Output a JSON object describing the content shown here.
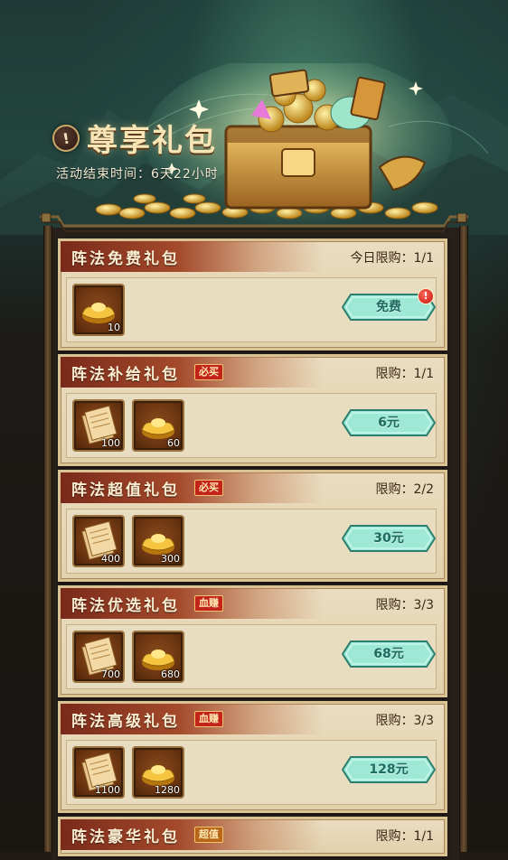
{
  "header": {
    "title_icon": "!",
    "title": "尊享礼包",
    "subtitle": "活动结束时间：6天22小时"
  },
  "colors": {
    "ribbon": "#a44a2c",
    "card_bg": "#e2d1ad",
    "button_teal": "#8fe0d0",
    "tag_red": "#c2241b",
    "tag_gold": "#b8661a"
  },
  "packages": [
    {
      "name": "阵法免费礼包",
      "tag": "",
      "limit": "今日限购：1/1",
      "items": [
        {
          "icon": "gold-ingot-icon",
          "count": "10"
        }
      ],
      "price": "免费",
      "badge": "!"
    },
    {
      "name": "阵法补给礼包",
      "tag": "必买",
      "limit": "限购：1/1",
      "items": [
        {
          "icon": "scroll-icon",
          "count": "100"
        },
        {
          "icon": "gold-ingot-icon",
          "count": "60"
        }
      ],
      "price": "6元"
    },
    {
      "name": "阵法超值礼包",
      "tag": "必买",
      "limit": "限购：2/2",
      "items": [
        {
          "icon": "scroll-icon",
          "count": "400"
        },
        {
          "icon": "gold-ingot-icon",
          "count": "300"
        }
      ],
      "price": "30元"
    },
    {
      "name": "阵法优选礼包",
      "tag": "血赚",
      "limit": "限购：3/3",
      "items": [
        {
          "icon": "scroll-icon",
          "count": "700"
        },
        {
          "icon": "gold-ingot-icon",
          "count": "680"
        }
      ],
      "price": "68元"
    },
    {
      "name": "阵法高级礼包",
      "tag": "血赚",
      "limit": "限购：3/3",
      "items": [
        {
          "icon": "scroll-icon",
          "count": "1100"
        },
        {
          "icon": "gold-ingot-icon",
          "count": "1280"
        }
      ],
      "price": "128元"
    },
    {
      "name": "阵法豪华礼包",
      "tag": "超值",
      "limit": "限购：1/1"
    }
  ]
}
